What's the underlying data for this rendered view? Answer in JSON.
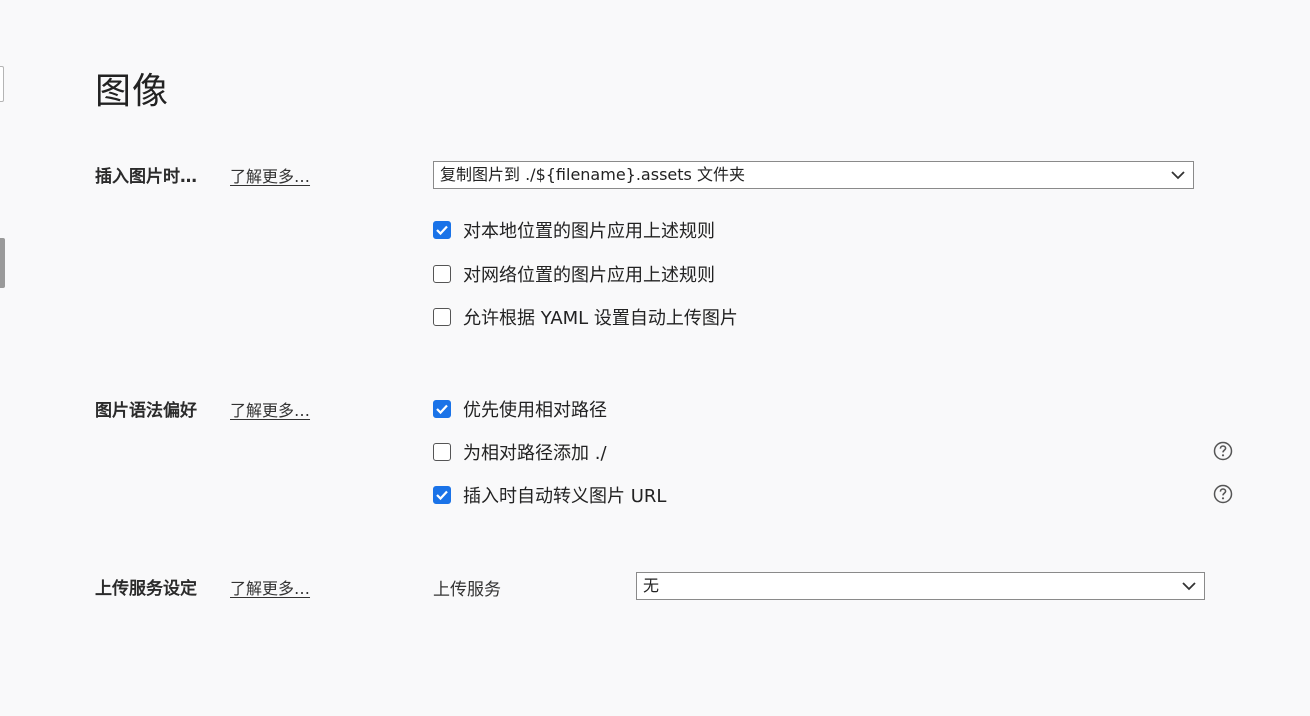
{
  "page_title": "图像",
  "insert_section": {
    "label": "插入图片时…",
    "learn_more": "了解更多…",
    "select_value": "复制图片到 ./${filename}.assets 文件夹",
    "options": [
      {
        "label": "对本地位置的图片应用上述规则",
        "checked": true
      },
      {
        "label": "对网络位置的图片应用上述规则",
        "checked": false
      },
      {
        "label": "允许根据 YAML 设置自动上传图片",
        "checked": false
      }
    ]
  },
  "syntax_section": {
    "label": "图片语法偏好",
    "learn_more": "了解更多…",
    "options": [
      {
        "label": "优先使用相对路径",
        "checked": true,
        "help": false
      },
      {
        "label": "为相对路径添加 ./",
        "checked": false,
        "help": true
      },
      {
        "label": "插入时自动转义图片 URL",
        "checked": true,
        "help": true
      }
    ]
  },
  "upload_section": {
    "label": "上传服务设定",
    "learn_more": "了解更多…",
    "field_label": "上传服务",
    "select_value": "无"
  },
  "icons": {
    "check": "checkmark-icon",
    "chevron": "chevron-down-icon",
    "help": "help-circle-icon"
  },
  "colors": {
    "accent": "#1a73e8",
    "background": "#f9f9fa"
  }
}
